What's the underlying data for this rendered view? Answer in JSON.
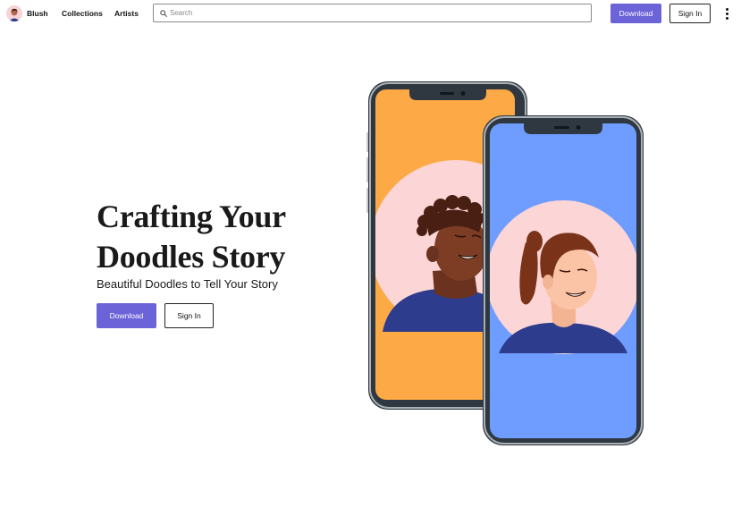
{
  "header": {
    "brand": "Blush",
    "nav": [
      "Collections",
      "Artists"
    ],
    "search": {
      "placeholder": "Search",
      "value": ""
    },
    "download_label": "Download",
    "signin_label": "Sign In"
  },
  "hero": {
    "title_line1": "Crafting Your",
    "title_line2": "Doodles Story",
    "subtitle": "Beautiful Doodles to Tell Your Story",
    "download_label": "Download",
    "signin_label": "Sign In"
  },
  "colors": {
    "accent": "#6c63d9",
    "phone_back_screen": "#fca946",
    "phone_front_screen": "#6f9cff",
    "avatar_bg": "#fcd6d6",
    "shirt": "#2d3c8c"
  }
}
